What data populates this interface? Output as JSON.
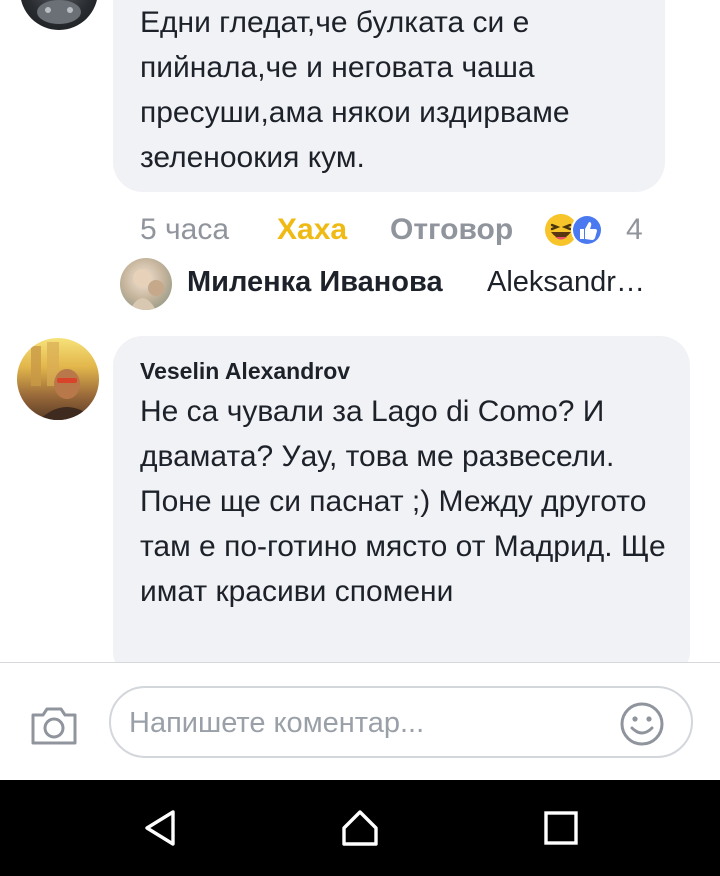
{
  "comments": [
    {
      "author": "",
      "text": "Едни гледат,че булката си е пийнала,че и неговата чаша пресуши,ама някои издирваме зеленоокия кум.",
      "meta": {
        "time": "5 часа",
        "reaction_label": "Хаха",
        "reply_label": "Отговор",
        "reaction_icons": [
          "haha-emoji-icon",
          "like-icon"
        ],
        "reaction_count": "4"
      },
      "reply_preview": {
        "author": "Миленка Иванова",
        "text": "Aleksandr…"
      }
    },
    {
      "author": "Veselin Alexandrov",
      "text": "Не са чували за Lago di Como?  И двамата? Уау, това ме развесели. Поне ще си паснат ;) Между другото там е по-готино място от Мадрид. Ще имат красиви спомени"
    }
  ],
  "composer": {
    "placeholder": "Напишете коментар...",
    "value": ""
  },
  "colors": {
    "bubble": "#f1f2f5",
    "haha_accent": "#f0ba15",
    "meta_gray": "#90949c",
    "like_blue": "#4a79f0",
    "navbar": "#000000"
  }
}
